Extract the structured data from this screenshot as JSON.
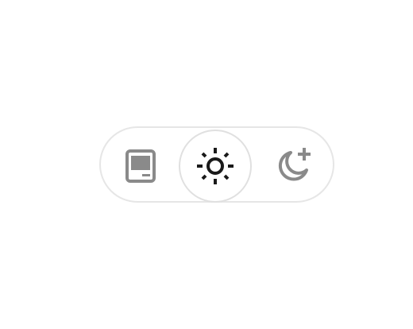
{
  "theme_switcher": {
    "selected": "light",
    "options": [
      {
        "id": "system",
        "icon": "computer-icon",
        "color": "#8a8a8a"
      },
      {
        "id": "light",
        "icon": "sun-icon",
        "color": "#1a1a1a"
      },
      {
        "id": "dark",
        "icon": "moon-plus-icon",
        "color": "#8a8a8a"
      }
    ]
  },
  "colors": {
    "border": "#e6e6e6",
    "selected_border": "#e0e0e0",
    "icon_active": "#1a1a1a",
    "icon_inactive": "#8a8a8a",
    "background": "#ffffff"
  }
}
